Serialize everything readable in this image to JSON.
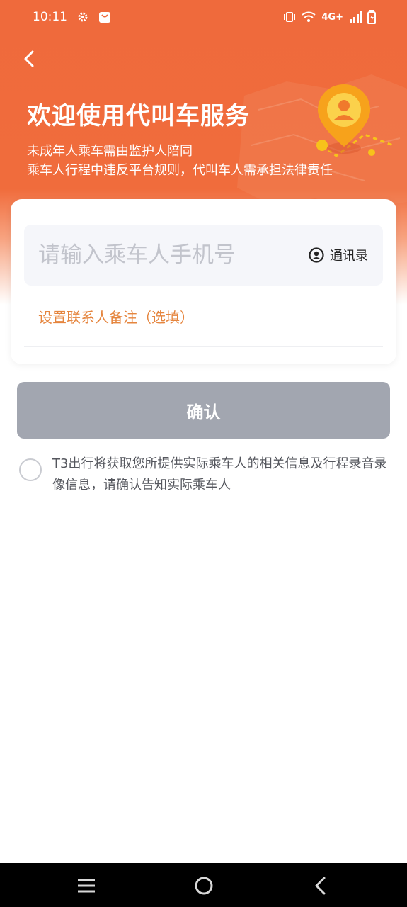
{
  "status_bar": {
    "time": "10:11",
    "network": "4G+",
    "icons": [
      "settings-icon",
      "shopping-bag-icon",
      "vibrate-icon",
      "wifi-icon",
      "signal-icon",
      "battery-icon"
    ]
  },
  "header": {
    "title": "欢迎使用代叫车服务",
    "subtitle_line1": "未成年人乘车需由监护人陪同",
    "subtitle_line2": "乘车人行程中违反平台规则，代叫车人需承担法律责任"
  },
  "form": {
    "phone_placeholder": "请输入乘车人手机号",
    "phone_value": "",
    "contacts_label": "通讯录",
    "remark_label": "设置联系人备注（选填）"
  },
  "confirm": {
    "label": "确认"
  },
  "agreement": {
    "checked": false,
    "text": "T3出行将获取您所提供实际乘车人的相关信息及行程录音录像信息，请确认告知实际乘车人"
  },
  "colors": {
    "brand_orange": "#ef6a3c",
    "remark_orange": "#e5853e",
    "confirm_disabled": "#a2a6b0",
    "pin_yellow": "#f7c21b"
  },
  "nav_icons": [
    "menu-icon",
    "home-icon",
    "back-icon"
  ]
}
